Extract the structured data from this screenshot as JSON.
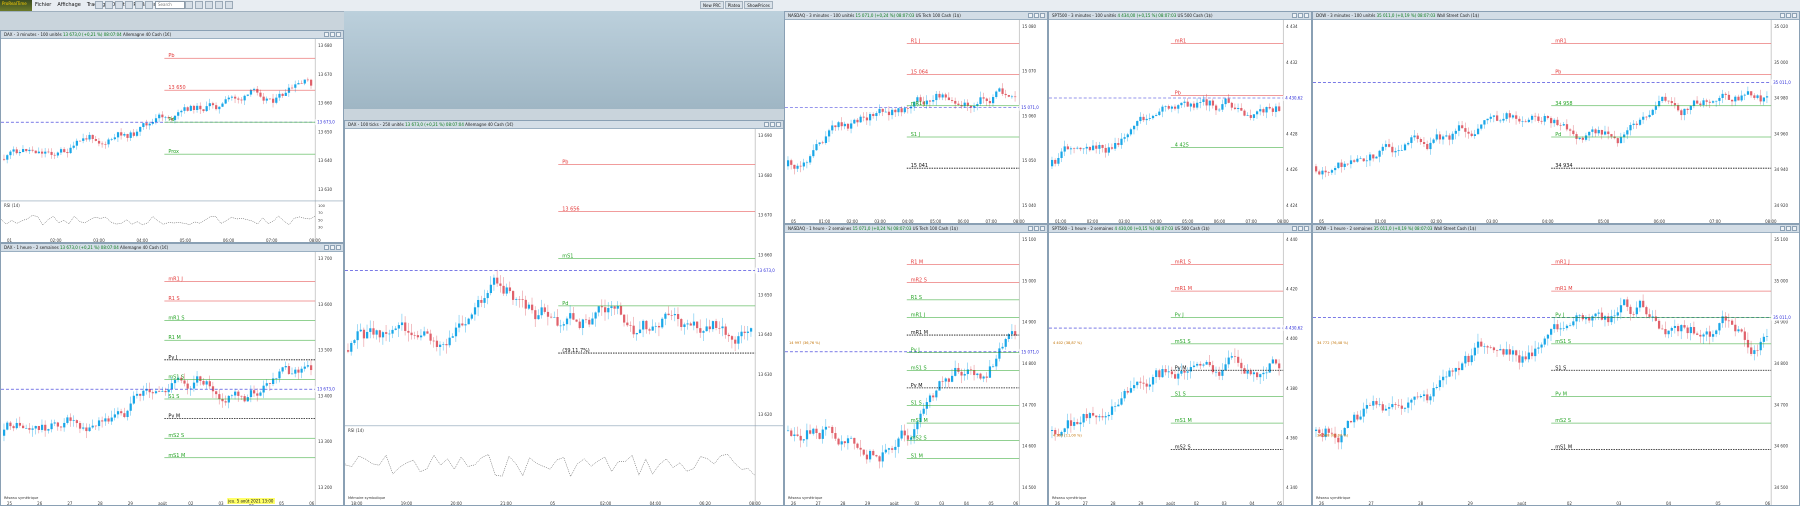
{
  "app": {
    "logo_text": "ProRealTime"
  },
  "menu": {
    "items": [
      "Fichier",
      "Affichage",
      "Trading",
      "Objets",
      "Réglages",
      "Aide"
    ]
  },
  "search": {
    "placeholder": "Search"
  },
  "top_buttons": [
    "New PRC",
    "Platea",
    "ShowPrices"
  ],
  "windows": [
    {
      "title": "DAX - 3 minutes - 100 unités",
      "price": "13 673,0 (+0,21 %) 08:07:04",
      "source": "Allemagne 40 Cash (1€)",
      "price_tag": "13 673,0",
      "levels": [
        "13 680",
        "13 670",
        "13 660",
        "13 650",
        "13 640",
        "13 630"
      ],
      "time_ticks": [
        "01",
        "02:00",
        "03:00",
        "04:00",
        "05:00",
        "06:00",
        "07:00",
        "08:00"
      ],
      "labels": [
        "Pb",
        "13 650",
        "Pd",
        "Prox"
      ],
      "sub_label": "RSI (14)",
      "sub_values": [
        "100",
        "70",
        "50",
        "30"
      ]
    },
    {
      "title": "DAX - 1 heure - 2 semaines",
      "price": "13 673,0 (+0,21 %) 08:07:04",
      "source": "Allemagne 40 Cash (1€)",
      "price_tag": "13 673,0",
      "levels": [
        "13 700",
        "13 600",
        "13 500",
        "13 400",
        "13 300",
        "13 200"
      ],
      "time_ticks": [
        "25",
        "26",
        "27",
        "28",
        "29",
        "août",
        "02",
        "03",
        "04",
        "05",
        "06"
      ],
      "labels": [
        "mR1 J",
        "R1 S",
        "mR1 S",
        "R1 M",
        "Pv J",
        "mS1 S",
        "S1 S",
        "Pv M",
        "mS2 S",
        "mS1 M"
      ],
      "date_badge": "jeu. 5 août 2021 13:00",
      "footer": "Réseau symétrique"
    },
    {
      "title": "DAX - 100 ticks - 250 unités",
      "price": "13 673,0 (+0,21 %) 08:07:04",
      "source": "Allemagne 40 Cash (1€)",
      "price_tag": "13 673,0",
      "levels": [
        "13 690",
        "13 680",
        "13 670",
        "13 660",
        "13 650",
        "13 640",
        "13 630",
        "13 620"
      ],
      "time_ticks": [
        "18:00",
        "19:00",
        "20:00",
        "21:00",
        "05",
        "02:00",
        "04:00",
        "06:20",
        "08:00"
      ],
      "labels": [
        "Pb",
        "13 656",
        "mS1",
        "Pd",
        "(39.11.7%)"
      ],
      "sub_label": "RSI (14)",
      "footer": "Mémoire symbolique"
    },
    {
      "title": "NASDAQ - 3 minutes - 100 unités",
      "price": "15 071,0 (+0,24 %) 08:07:03",
      "source": "US Tech 100 Cash (1$)",
      "price_tag": "15 071,0",
      "levels": [
        "15 080",
        "15 070",
        "15 060",
        "15 050",
        "15 040"
      ],
      "time_ticks": [
        "05",
        "01:00",
        "02:00",
        "03:00",
        "04:00",
        "05:00",
        "06:00",
        "07:00",
        "08:00"
      ],
      "labels": [
        "R1 J",
        "15 064",
        "mR1 J",
        "S1 J",
        "15 041"
      ]
    },
    {
      "title": "NASDAQ - 1 heure - 2 semaines",
      "price": "15 071,0 (+0,24 %) 08:07:03",
      "source": "US Tech 100 Cash (1$)",
      "price_tag": "15 071,0",
      "levels": [
        "15 100",
        "15 000",
        "14 900",
        "14 800",
        "14 700",
        "14 600",
        "14 500"
      ],
      "time_ticks": [
        "26",
        "27",
        "28",
        "29",
        "août",
        "02",
        "03",
        "04",
        "05",
        "06"
      ],
      "labels": [
        "R1 M",
        "mR2 S",
        "R1 S",
        "mR1 J",
        "mR1 M",
        "Pv J",
        "mS1 S",
        "Pv M",
        "S1 S",
        "mS1 M",
        "mS2 S",
        "S1 M"
      ],
      "sub_labels": [
        "14 997 (36,76 %)"
      ],
      "footer": "Réseau symétrique"
    },
    {
      "title": "SPT500 - 3 minutes - 100 unités",
      "price": "4 434,00 (+0,15 %) 08:07:03",
      "source": "US 500 Cash (1$)",
      "price_tag": "4 430,62",
      "levels": [
        "4 434",
        "4 432",
        "4 430",
        "4 428",
        "4 426",
        "4 424"
      ],
      "time_ticks": [
        "01:00",
        "02:00",
        "03:00",
        "04:00",
        "05:00",
        "06:00",
        "07:00",
        "08:00"
      ],
      "labels": [
        "mR1",
        "Pb",
        "4 425"
      ]
    },
    {
      "title": "SPT500 - 1 heure - 2 semaines",
      "price": "4 430,00 (+0,15 %) 08:07:03",
      "source": "US 500 Cash (1$)",
      "price_tag": "4 430,62",
      "levels": [
        "4 440",
        "4 420",
        "4 400",
        "4 380",
        "4 360",
        "4 340"
      ],
      "time_ticks": [
        "26",
        "27",
        "28",
        "29",
        "août",
        "02",
        "03",
        "04",
        "05"
      ],
      "labels": [
        "mR1 S",
        "mR1 M",
        "Pv J",
        "mS1 S",
        "Pv M",
        "S1 S",
        "mS1 M",
        "mS2 S"
      ],
      "sub_labels": [
        "4 402 (38,87 %)",
        "4 363 (11,00 %)"
      ],
      "footer": "Réseau symétrique"
    },
    {
      "title": "DOW - 3 minutes - 100 unités",
      "price": "35 011,0 (+0,19 %) 08:07:03",
      "source": "Wall Street Cash (1$)",
      "price_tag": "35 011,0",
      "levels": [
        "35 020",
        "35 000",
        "34 980",
        "34 960",
        "34 940",
        "34 920"
      ],
      "time_ticks": [
        "05",
        "01:00",
        "02:00",
        "03:00",
        "04:00",
        "05:00",
        "06:00",
        "07:00",
        "08:00"
      ],
      "labels": [
        "mR1",
        "Pb",
        "34 958",
        "Pd",
        "34 934"
      ]
    },
    {
      "title": "DOW - 1 heure - 2 semaines",
      "price": "35 011,0 (+0,19 %) 08:07:03",
      "source": "Wall Street Cash (1$)",
      "price_tag": "35 011,0",
      "levels": [
        "35 100",
        "35 000",
        "34 900",
        "34 800",
        "34 700",
        "34 600",
        "34 500"
      ],
      "time_ticks": [
        "26",
        "27",
        "28",
        "29",
        "août",
        "02",
        "03",
        "04",
        "05",
        "06"
      ],
      "labels": [
        "mR1 J",
        "mR1 M",
        "Pv J",
        "mS1 S",
        "S1 S",
        "Pv M",
        "mS2 S",
        "mS1 M"
      ],
      "sub_labels": [
        "34 772 (76,48 %)",
        "34 548 (00,00 %)"
      ],
      "footer": "Réseau symétrique"
    }
  ],
  "colors": {
    "up": "#1aa7e8",
    "down": "#e0616b",
    "pivot": "#2b2bd8",
    "green": "#23a323",
    "red": "#e33a3a",
    "pink": "#e85aa8"
  }
}
